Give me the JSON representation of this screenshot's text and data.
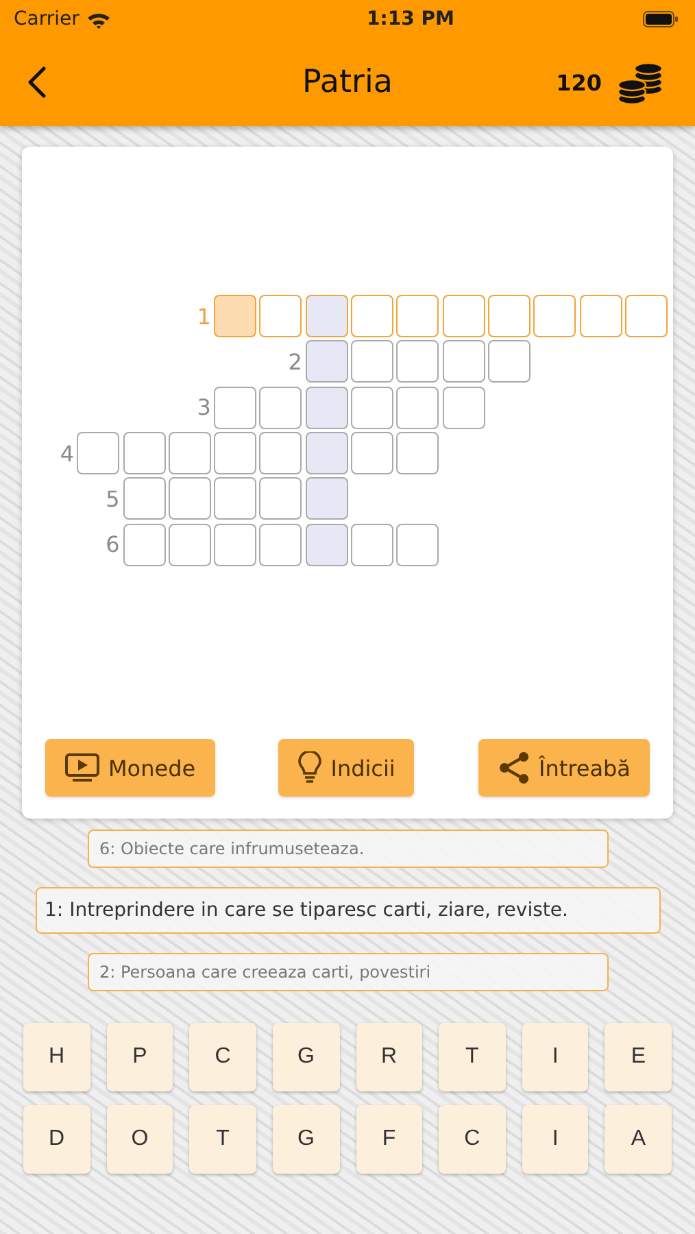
{
  "status_bar": {
    "carrier": "Carrier",
    "time": "1:13 PM"
  },
  "nav": {
    "title": "Patria",
    "coins": "120"
  },
  "grid": [
    {
      "number": "1",
      "selected": true,
      "cells": [
        {
          "kind": "blank"
        },
        {
          "kind": "blank"
        },
        {
          "kind": "blank"
        },
        {
          "kind": "active"
        },
        {
          "kind": "plain"
        },
        {
          "kind": "key"
        },
        {
          "kind": "plain"
        },
        {
          "kind": "plain"
        },
        {
          "kind": "plain"
        },
        {
          "kind": "plain"
        },
        {
          "kind": "plain"
        },
        {
          "kind": "plain"
        },
        {
          "kind": "plain"
        }
      ]
    },
    {
      "number": "2",
      "selected": false,
      "cells": [
        {
          "kind": "blank"
        },
        {
          "kind": "blank"
        },
        {
          "kind": "blank"
        },
        {
          "kind": "blank"
        },
        {
          "kind": "blank"
        },
        {
          "kind": "key"
        },
        {
          "kind": "plain"
        },
        {
          "kind": "plain"
        },
        {
          "kind": "plain"
        },
        {
          "kind": "plain"
        }
      ]
    },
    {
      "number": "3",
      "selected": false,
      "cells": [
        {
          "kind": "blank"
        },
        {
          "kind": "blank"
        },
        {
          "kind": "blank"
        },
        {
          "kind": "plain"
        },
        {
          "kind": "plain"
        },
        {
          "kind": "key"
        },
        {
          "kind": "plain"
        },
        {
          "kind": "plain"
        },
        {
          "kind": "plain"
        }
      ]
    },
    {
      "number": "4",
      "selected": false,
      "cells": [
        {
          "kind": "plain"
        },
        {
          "kind": "plain"
        },
        {
          "kind": "plain"
        },
        {
          "kind": "plain"
        },
        {
          "kind": "plain"
        },
        {
          "kind": "key"
        },
        {
          "kind": "plain"
        },
        {
          "kind": "plain"
        }
      ]
    },
    {
      "number": "5",
      "selected": false,
      "cells": [
        {
          "kind": "blank"
        },
        {
          "kind": "plain"
        },
        {
          "kind": "plain"
        },
        {
          "kind": "plain"
        },
        {
          "kind": "plain"
        },
        {
          "kind": "key"
        }
      ]
    },
    {
      "number": "6",
      "selected": false,
      "cells": [
        {
          "kind": "blank"
        },
        {
          "kind": "plain"
        },
        {
          "kind": "plain"
        },
        {
          "kind": "plain"
        },
        {
          "kind": "plain"
        },
        {
          "kind": "key"
        },
        {
          "kind": "plain"
        },
        {
          "kind": "plain"
        }
      ]
    }
  ],
  "actions": [
    {
      "kind": "video",
      "label": "Monede"
    },
    {
      "kind": "bulb",
      "label": "Indicii"
    },
    {
      "kind": "share",
      "label": "Întreabă"
    }
  ],
  "clues": [
    {
      "text": "6: Obiecte care infrumuseteaza.",
      "selected": false
    },
    {
      "text": "1: Intreprindere in care se tiparesc carti, ziare, reviste.",
      "selected": true
    },
    {
      "text": "2: Persoana care creeaza carti, povestiri",
      "selected": false
    }
  ],
  "keyboard": [
    [
      "H",
      "P",
      "C",
      "G",
      "R",
      "T",
      "I",
      "E"
    ],
    [
      "D",
      "O",
      "T",
      "G",
      "F",
      "C",
      "I",
      "A"
    ]
  ]
}
